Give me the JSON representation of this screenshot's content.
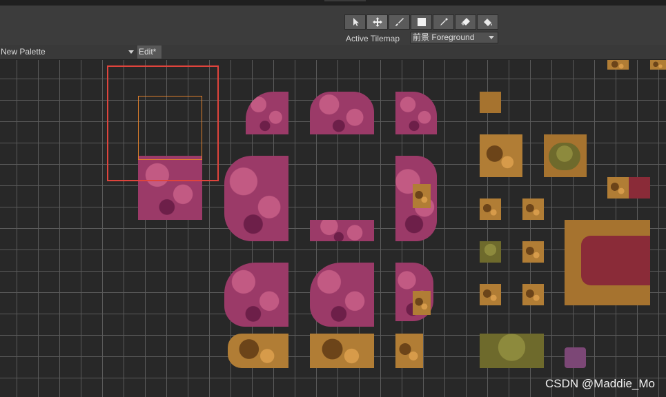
{
  "toolbar": {
    "tools": [
      {
        "name": "select-tool",
        "icon": "arrow-pointer-icon"
      },
      {
        "name": "move-tool",
        "icon": "move-arrows-icon"
      },
      {
        "name": "paint-tool",
        "icon": "brush-icon"
      },
      {
        "name": "box-fill-tool",
        "icon": "box-icon"
      },
      {
        "name": "picker-tool",
        "icon": "eyedropper-icon"
      },
      {
        "name": "erase-tool",
        "icon": "eraser-icon"
      },
      {
        "name": "fill-tool",
        "icon": "paint-bucket-icon"
      }
    ],
    "active_tilemap_label": "Active Tilemap",
    "active_tilemap_value": "前景 Foreground"
  },
  "palette_bar": {
    "palette_name": "New Palette",
    "edit_label": "Edit*"
  },
  "colors": {
    "highlight": "#e0443c",
    "selection": "#e0802c",
    "tree_pink": "#9b3a68",
    "ground_gold": "#a6732f"
  },
  "watermark": "CSDN @Maddie_Mo"
}
